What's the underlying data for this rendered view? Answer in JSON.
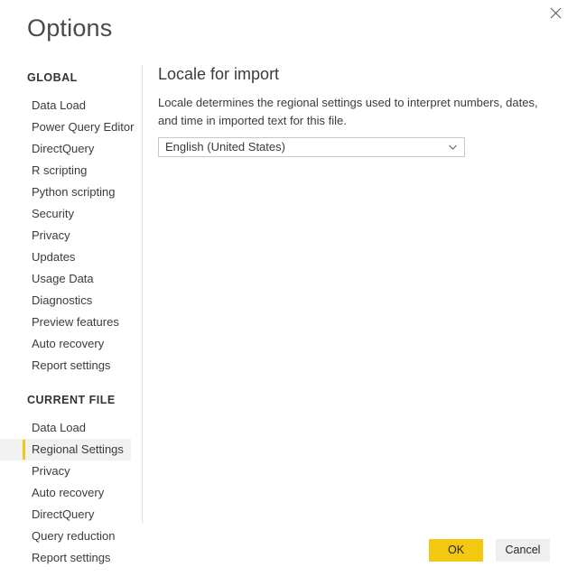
{
  "dialog": {
    "title": "Options",
    "close_icon": "close-icon"
  },
  "sidebar": {
    "sections": [
      {
        "header": "GLOBAL",
        "items": [
          {
            "label": "Data Load",
            "selected": false
          },
          {
            "label": "Power Query Editor",
            "selected": false
          },
          {
            "label": "DirectQuery",
            "selected": false
          },
          {
            "label": "R scripting",
            "selected": false
          },
          {
            "label": "Python scripting",
            "selected": false
          },
          {
            "label": "Security",
            "selected": false
          },
          {
            "label": "Privacy",
            "selected": false
          },
          {
            "label": "Updates",
            "selected": false
          },
          {
            "label": "Usage Data",
            "selected": false
          },
          {
            "label": "Diagnostics",
            "selected": false
          },
          {
            "label": "Preview features",
            "selected": false
          },
          {
            "label": "Auto recovery",
            "selected": false
          },
          {
            "label": "Report settings",
            "selected": false
          }
        ]
      },
      {
        "header": "CURRENT FILE",
        "items": [
          {
            "label": "Data Load",
            "selected": false
          },
          {
            "label": "Regional Settings",
            "selected": true
          },
          {
            "label": "Privacy",
            "selected": false
          },
          {
            "label": "Auto recovery",
            "selected": false
          },
          {
            "label": "DirectQuery",
            "selected": false
          },
          {
            "label": "Query reduction",
            "selected": false
          },
          {
            "label": "Report settings",
            "selected": false
          }
        ]
      }
    ]
  },
  "content": {
    "heading": "Locale for import",
    "description": "Locale determines the regional settings used to interpret numbers, dates, and time in imported text for this file.",
    "locale_select": {
      "value": "English (United States)",
      "chevron_icon": "chevron-down-icon"
    }
  },
  "footer": {
    "ok_label": "OK",
    "cancel_label": "Cancel"
  },
  "colors": {
    "accent_yellow": "#f2c811",
    "selected_row_bg": "#f1f1f1",
    "cancel_bg": "#efefef",
    "divider": "#e5e5e5"
  }
}
